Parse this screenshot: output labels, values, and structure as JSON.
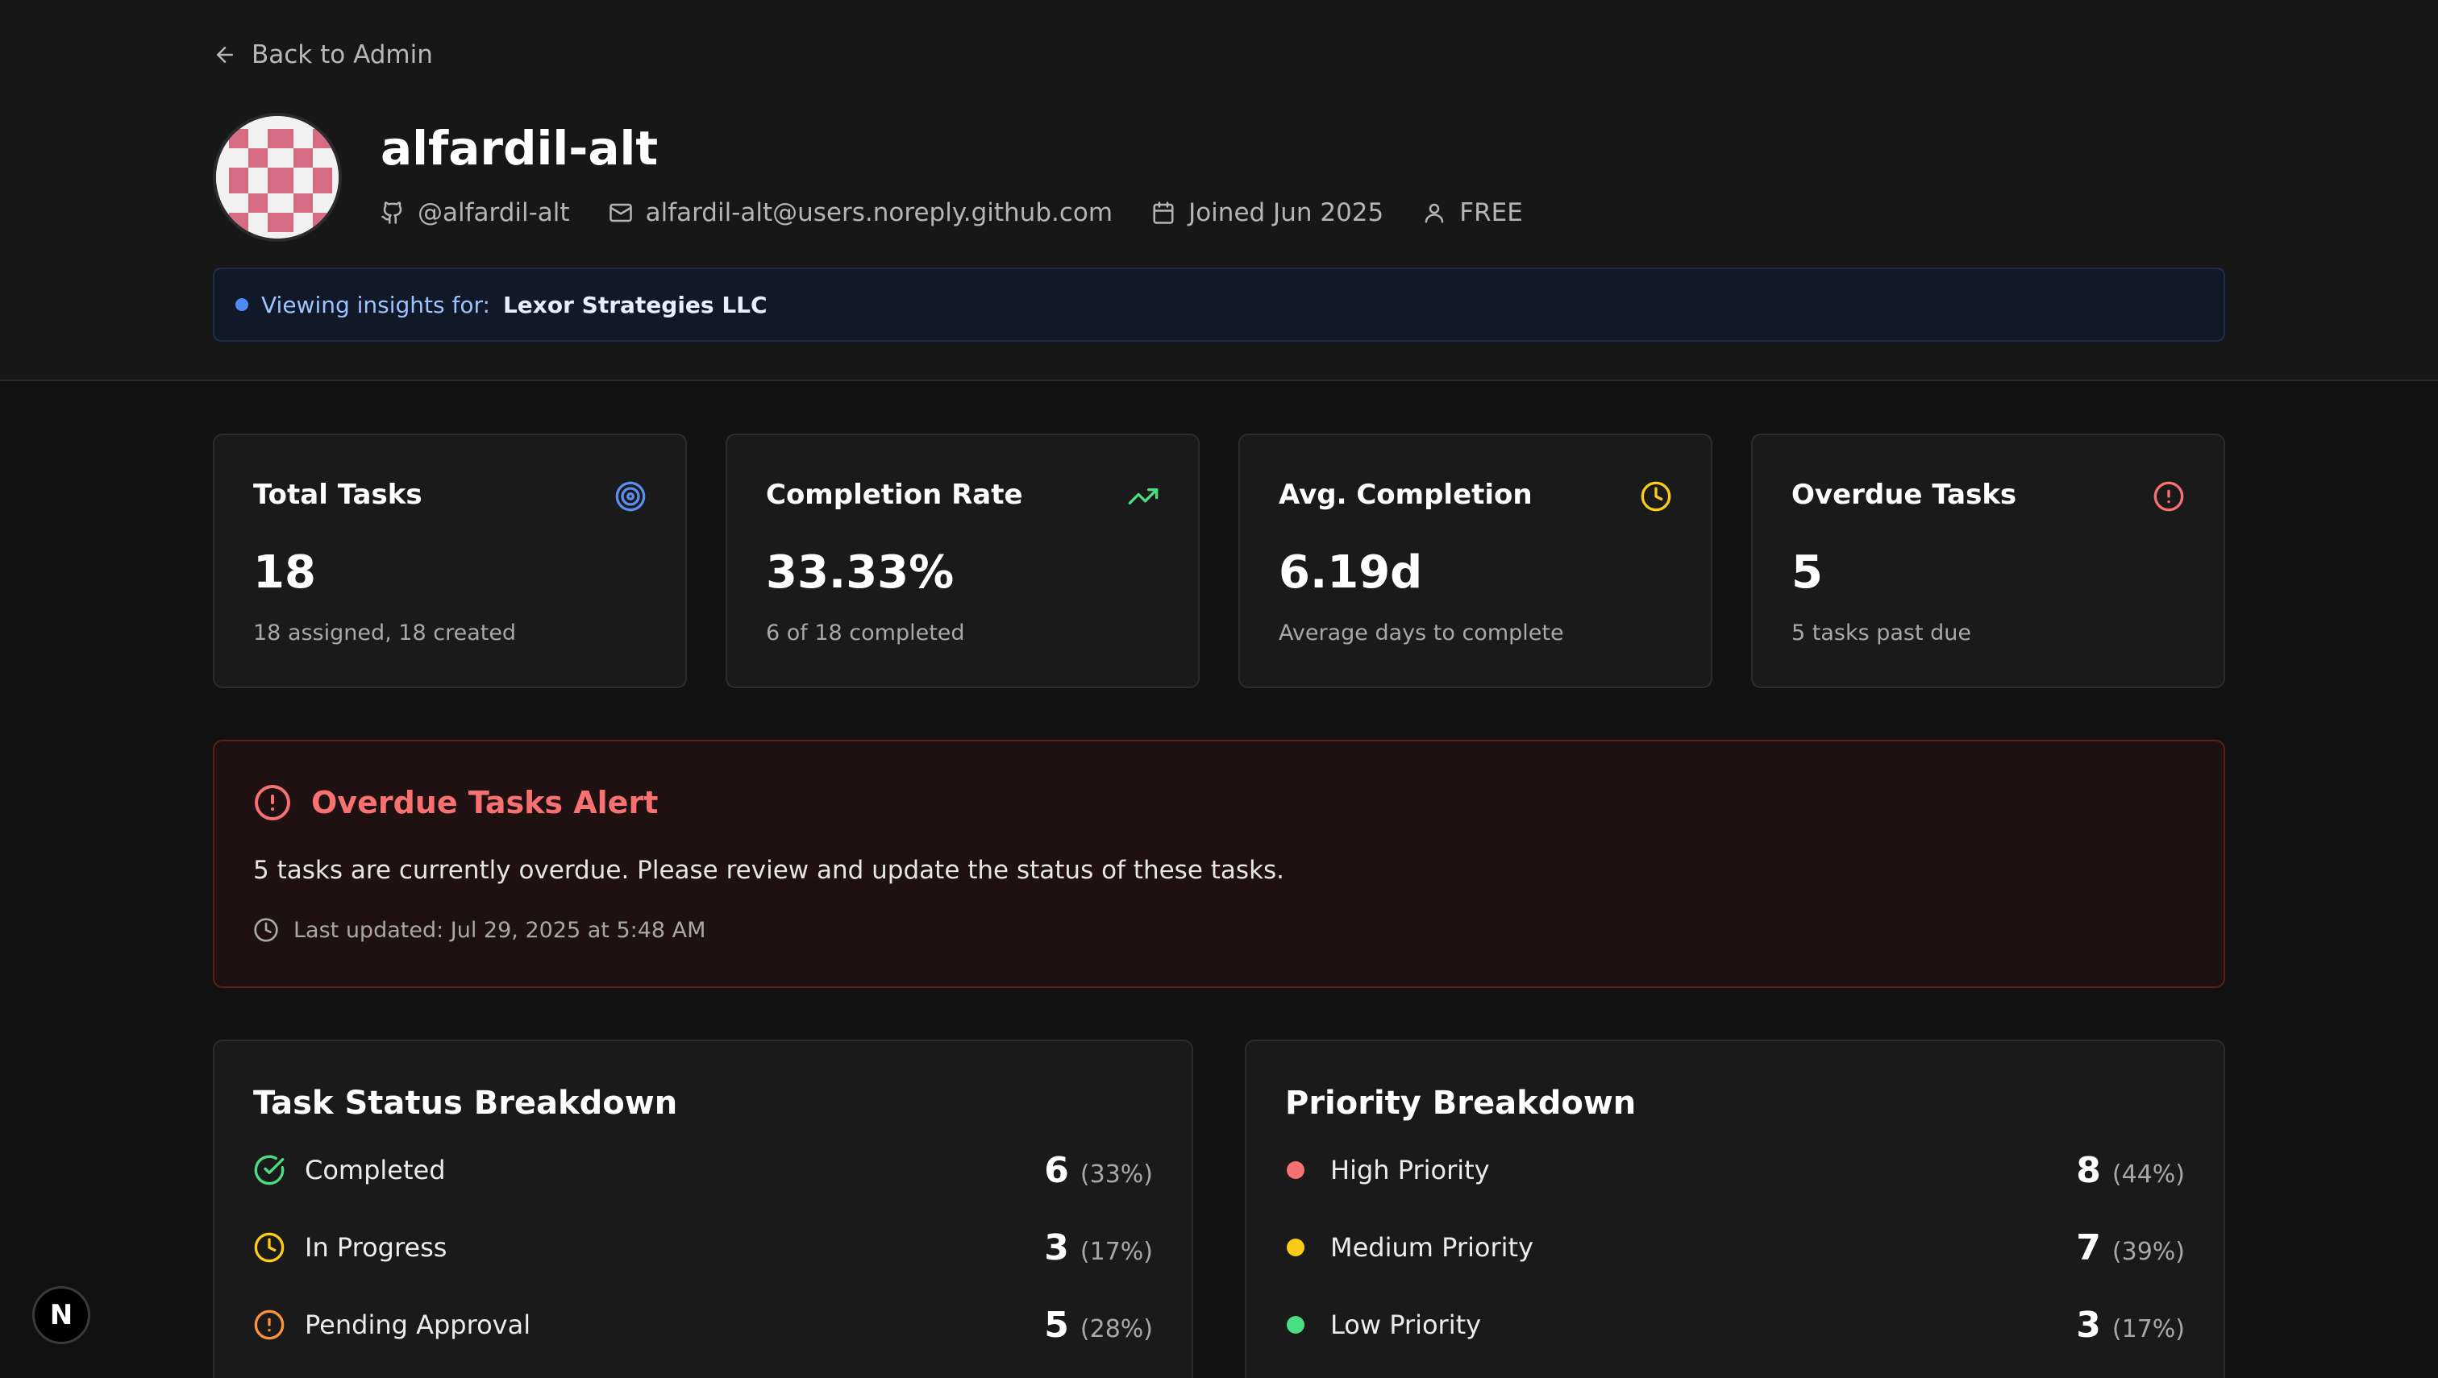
{
  "nav": {
    "back_label": "Back to Admin"
  },
  "profile": {
    "username": "alfardil-alt",
    "github_handle": "@alfardil-alt",
    "email": "alfardil-alt@users.noreply.github.com",
    "joined": "Joined Jun 2025",
    "plan": "FREE"
  },
  "insights": {
    "prefix": "Viewing insights for:",
    "organization": "Lexor Strategies LLC"
  },
  "stats": [
    {
      "title": "Total Tasks",
      "value": "18",
      "subtitle": "18 assigned, 18 created",
      "icon": "target-icon",
      "color": "#5b8def"
    },
    {
      "title": "Completion Rate",
      "value": "33.33%",
      "subtitle": "6 of 18 completed",
      "icon": "trending-up-icon",
      "color": "#4ade80"
    },
    {
      "title": "Avg. Completion",
      "value": "6.19d",
      "subtitle": "Average days to complete",
      "icon": "clock-icon",
      "color": "#facc15"
    },
    {
      "title": "Overdue Tasks",
      "value": "5",
      "subtitle": "5 tasks past due",
      "icon": "alert-circle-icon",
      "color": "#f87171"
    }
  ],
  "alert": {
    "title": "Overdue Tasks Alert",
    "message": "5 tasks are currently overdue. Please review and update the status of these tasks.",
    "last_updated": "Last updated: Jul 29, 2025 at 5:48 AM",
    "color": "#f87171"
  },
  "status_breakdown": {
    "title": "Task Status Breakdown",
    "items": [
      {
        "label": "Completed",
        "count": "6",
        "percent": "(33%)",
        "icon": "check-circle-icon",
        "color": "#4ade80"
      },
      {
        "label": "In Progress",
        "count": "3",
        "percent": "(17%)",
        "icon": "clock-icon",
        "color": "#facc15"
      },
      {
        "label": "Pending Approval",
        "count": "5",
        "percent": "(28%)",
        "icon": "alert-circle-icon",
        "color": "#fb923c"
      }
    ]
  },
  "priority_breakdown": {
    "title": "Priority Breakdown",
    "items": [
      {
        "label": "High Priority",
        "count": "8",
        "percent": "(44%)",
        "color": "#f87171"
      },
      {
        "label": "Medium Priority",
        "count": "7",
        "percent": "(39%)",
        "color": "#facc15"
      },
      {
        "label": "Low Priority",
        "count": "3",
        "percent": "(17%)",
        "color": "#4ade80"
      }
    ]
  },
  "dev_badge": {
    "label": "N"
  }
}
